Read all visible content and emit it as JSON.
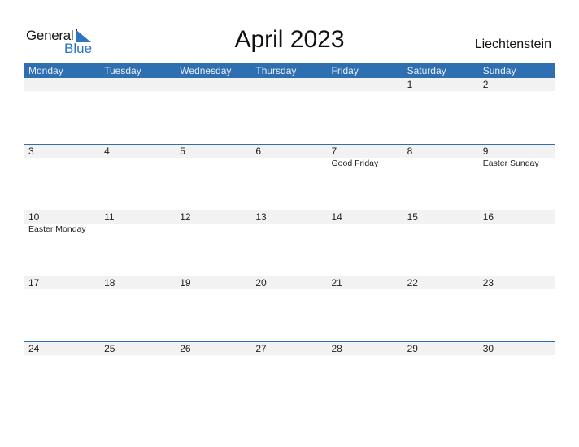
{
  "logo": {
    "line1": "General",
    "line2": "Blue"
  },
  "title": "April 2023",
  "country": "Liechtenstein",
  "colors": {
    "accent": "#2e6fb1",
    "row_bg": "#f2f2f2"
  },
  "days": [
    "Monday",
    "Tuesday",
    "Wednesday",
    "Thursday",
    "Friday",
    "Saturday",
    "Sunday"
  ],
  "weeks": [
    {
      "dates": [
        "",
        "",
        "",
        "",
        "",
        "1",
        "2"
      ],
      "events": [
        "",
        "",
        "",
        "",
        "",
        "",
        ""
      ]
    },
    {
      "dates": [
        "3",
        "4",
        "5",
        "6",
        "7",
        "8",
        "9"
      ],
      "events": [
        "",
        "",
        "",
        "",
        "Good Friday",
        "",
        "Easter Sunday"
      ]
    },
    {
      "dates": [
        "10",
        "11",
        "12",
        "13",
        "14",
        "15",
        "16"
      ],
      "events": [
        "Easter Monday",
        "",
        "",
        "",
        "",
        "",
        ""
      ]
    },
    {
      "dates": [
        "17",
        "18",
        "19",
        "20",
        "21",
        "22",
        "23"
      ],
      "events": [
        "",
        "",
        "",
        "",
        "",
        "",
        ""
      ]
    },
    {
      "dates": [
        "24",
        "25",
        "26",
        "27",
        "28",
        "29",
        "30"
      ],
      "events": [
        "",
        "",
        "",
        "",
        "",
        "",
        ""
      ]
    }
  ]
}
